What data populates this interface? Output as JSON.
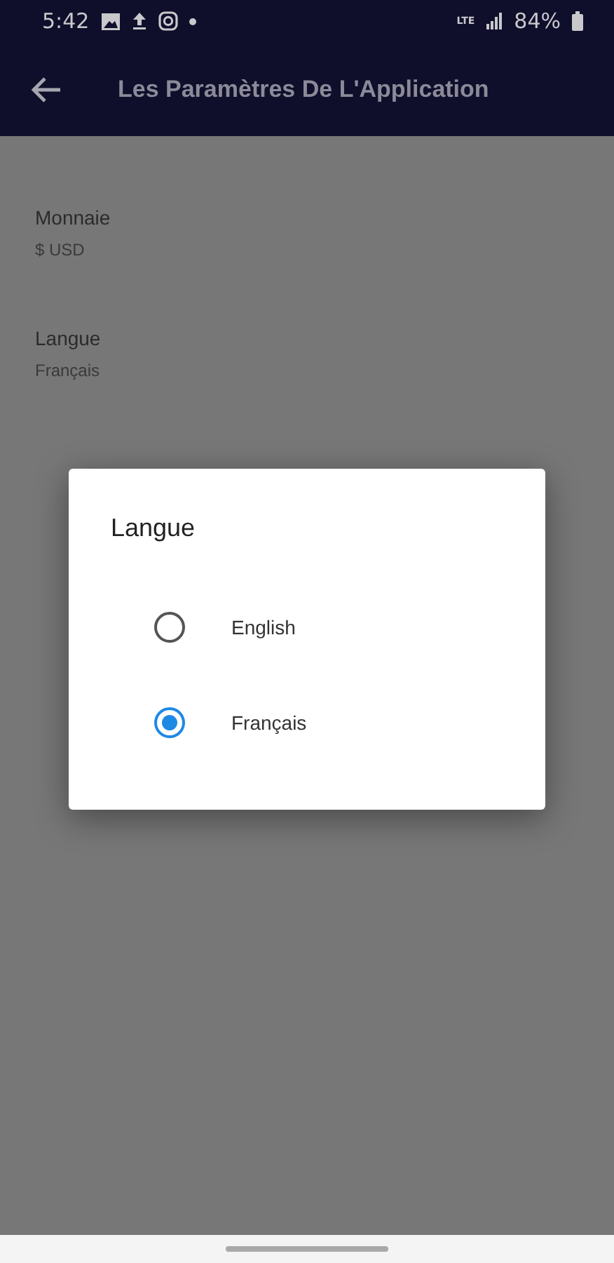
{
  "status_bar": {
    "time": "5:42",
    "network": "LTE",
    "battery": "84%"
  },
  "app_bar": {
    "title": "Les Paramètres De L'Application"
  },
  "settings": [
    {
      "label": "Monnaie",
      "value": "$ USD"
    },
    {
      "label": "Langue",
      "value": "Français"
    }
  ],
  "dialog": {
    "title": "Langue",
    "options": [
      {
        "label": "English",
        "selected": false
      },
      {
        "label": "Français",
        "selected": true
      }
    ]
  }
}
